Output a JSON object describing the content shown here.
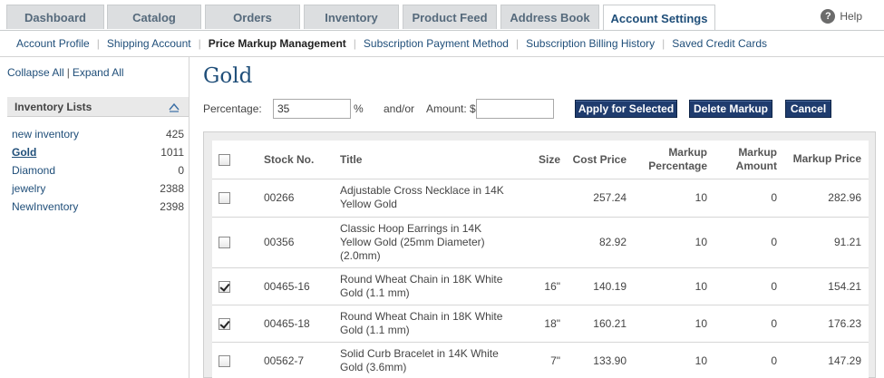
{
  "tabs": [
    {
      "label": "Dashboard"
    },
    {
      "label": "Catalog"
    },
    {
      "label": "Orders"
    },
    {
      "label": "Inventory"
    },
    {
      "label": "Product Feed"
    },
    {
      "label": "Address Book"
    },
    {
      "label": "Account Settings",
      "active": true
    }
  ],
  "help_label": "Help",
  "subnav": [
    {
      "label": "Account Profile"
    },
    {
      "label": "Shipping Account"
    },
    {
      "label": "Price Markup Management",
      "active": true
    },
    {
      "label": "Subscription Payment Method"
    },
    {
      "label": "Subscription Billing History"
    },
    {
      "label": "Saved Credit Cards"
    }
  ],
  "sidebar": {
    "collapse_all": "Collapse All",
    "expand_all": "Expand All",
    "header": "Inventory Lists",
    "items": [
      {
        "name": "new inventory",
        "count": "425"
      },
      {
        "name": "Gold",
        "count": "1011",
        "selected": true
      },
      {
        "name": "Diamond",
        "count": "0"
      },
      {
        "name": "jewelry",
        "count": "2388"
      },
      {
        "name": "NewInventory",
        "count": "2398"
      }
    ]
  },
  "main": {
    "title": "Gold",
    "percentage_label": "Percentage:",
    "percentage_value": "35",
    "percent_sign": "%",
    "andor_label": "and/or",
    "amount_label": "Amount: $",
    "amount_value": "",
    "apply_button": "Apply for Selected",
    "delete_button": "Delete Markup",
    "cancel_button": "Cancel"
  },
  "table": {
    "headers": {
      "stock": "Stock No.",
      "title": "Title",
      "size": "Size",
      "cost": "Cost Price",
      "markup_pct": "Markup Percentage",
      "markup_amt": "Markup Amount",
      "markup_price": "Markup Price"
    },
    "rows": [
      {
        "checked": false,
        "stock": "00266",
        "title": "Adjustable Cross Necklace in 14K Yellow Gold",
        "size": "",
        "cost": "257.24",
        "markup_pct": "10",
        "markup_amt": "0",
        "markup_price": "282.96"
      },
      {
        "checked": false,
        "stock": "00356",
        "title": "Classic Hoop Earrings in 14K Yellow Gold (25mm Diameter) (2.0mm)",
        "size": "",
        "cost": "82.92",
        "markup_pct": "10",
        "markup_amt": "0",
        "markup_price": "91.21"
      },
      {
        "checked": true,
        "stock": "00465-16",
        "title": "Round Wheat Chain in 18K White Gold (1.1 mm)",
        "size": "16\"",
        "cost": "140.19",
        "markup_pct": "10",
        "markup_amt": "0",
        "markup_price": "154.21"
      },
      {
        "checked": true,
        "stock": "00465-18",
        "title": "Round Wheat Chain in 18K White Gold (1.1 mm)",
        "size": "18\"",
        "cost": "160.21",
        "markup_pct": "10",
        "markup_amt": "0",
        "markup_price": "176.23"
      },
      {
        "checked": false,
        "stock": "00562-7",
        "title": "Solid Curb Bracelet in 14K White Gold (3.6mm)",
        "size": "7\"",
        "cost": "133.90",
        "markup_pct": "10",
        "markup_amt": "0",
        "markup_price": "147.29"
      }
    ]
  }
}
